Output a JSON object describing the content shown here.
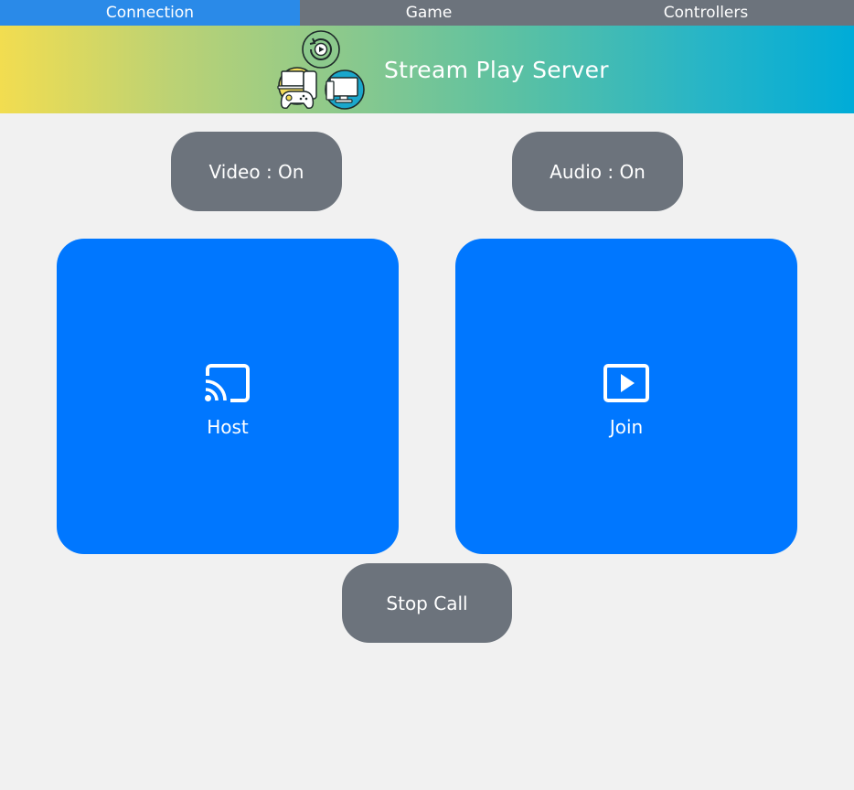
{
  "tabs": [
    {
      "label": "Connection",
      "active": true
    },
    {
      "label": "Game",
      "active": false
    },
    {
      "label": "Controllers",
      "active": false
    }
  ],
  "banner": {
    "title": "Stream Play Server",
    "logo_icon": "stream-play-logo-icon",
    "gradient_colors": [
      "#f2dd50",
      "#8cc98c",
      "#00acd8"
    ]
  },
  "controls": {
    "video_label": "Video : On",
    "audio_label": "Audio : On",
    "stop_label": "Stop Call"
  },
  "tiles": {
    "host": {
      "label": "Host",
      "icon": "cast-icon"
    },
    "join": {
      "label": "Join",
      "icon": "play-icon"
    }
  },
  "colors": {
    "active_tab": "#2a8ae8",
    "tab_bar": "#6c737c",
    "tile": "#0077ff",
    "pill": "#6c737c",
    "background": "#f1f1f1"
  }
}
